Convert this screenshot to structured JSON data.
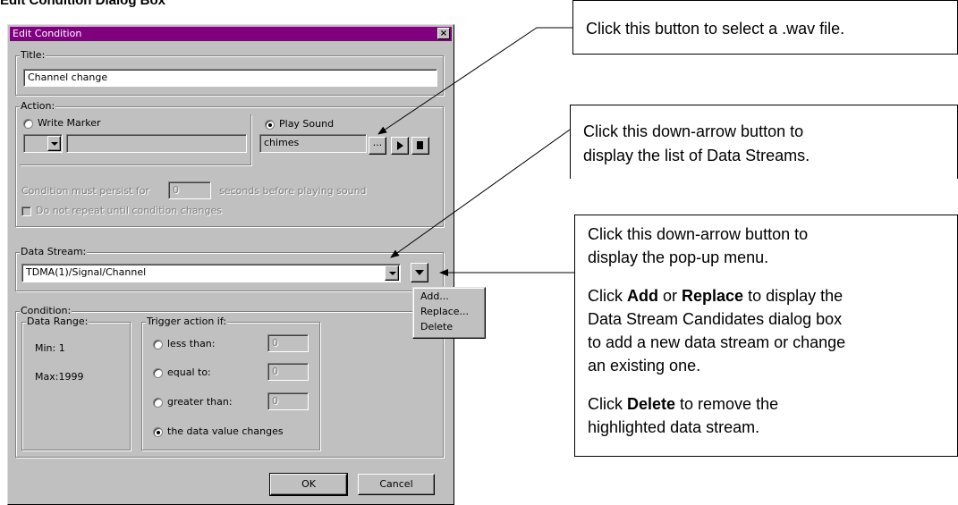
{
  "heading": "Edit Condition Dialog Box",
  "dialog": {
    "title": "Edit Condition",
    "close_glyph": "×",
    "title_group": {
      "legend": "Title:",
      "value": "Channel change"
    },
    "action_group": {
      "legend": "Action:",
      "write_marker_label": "Write Marker",
      "play_sound_label": "Play Sound",
      "sound_value": "chimes",
      "browse_label": "...",
      "persist_prefix": "Condition must persist for",
      "persist_value": "0",
      "persist_suffix": "seconds before playing sound",
      "no_repeat_label": "Do not repeat until condition changes"
    },
    "data_stream_group": {
      "legend": "Data Stream:",
      "value": "TDMA(1)/Signal/Channel"
    },
    "popup_menu": [
      "Add...",
      "Replace...",
      "Delete"
    ],
    "condition_group": {
      "legend": "Condition:",
      "range_legend": "Data Range:",
      "min_label": "Min: 1",
      "max_label": "Max:1999",
      "trigger_legend": "Trigger action if:",
      "less_than_label": "less than:",
      "equal_to_label": "equal to:",
      "greater_than_label": "greater than:",
      "changes_label": "the data value changes",
      "less_than_value": "0",
      "equal_to_value": "0",
      "greater_than_value": "0"
    },
    "ok_label": "OK",
    "cancel_label": "Cancel"
  },
  "callouts": {
    "wav": "Click this button to select a .wav file.",
    "streams_line1": "Click this down-arrow button to",
    "streams_line2": "display the list of Data Streams.",
    "popup_line1": "Click this down-arrow button to",
    "popup_line2": "display the pop-up menu.",
    "add_pre": "Click ",
    "add_bold1": "Add",
    "add_mid": " or ",
    "add_bold2": "Replace",
    "add_post": " to display the",
    "add_line2": "Data Stream Candidates dialog box",
    "add_line3": "to add a new data stream or change",
    "add_line4": "an existing one.",
    "del_pre": "Click ",
    "del_bold": "Delete",
    "del_post": " to remove the",
    "del_line2": "highlighted data stream."
  },
  "colors": {
    "titlebar": "#800080",
    "dialog_face": "#c0c0c0"
  },
  "icons": [
    "close-icon",
    "play-icon",
    "stop-icon",
    "dropdown-arrow-icon",
    "menu-arrow-icon",
    "callout-arrow"
  ]
}
